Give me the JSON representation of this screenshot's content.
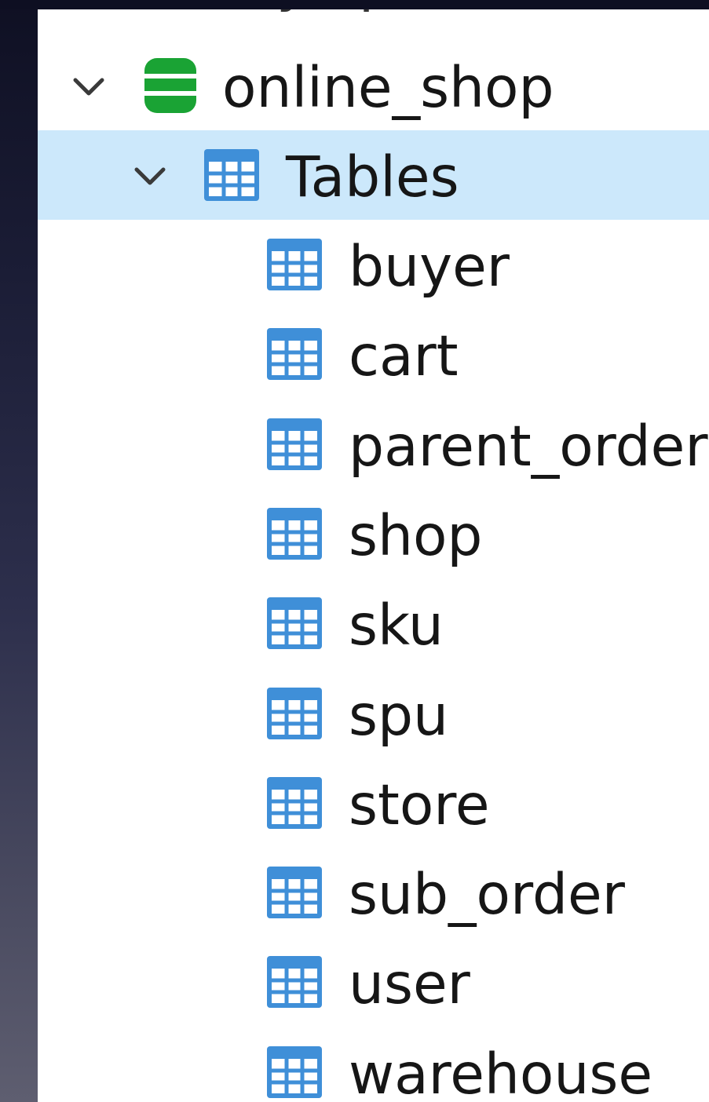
{
  "tree": {
    "connection": {
      "label": "mysql",
      "icon": "database-gray-icon"
    },
    "database": {
      "label": "online_shop",
      "icon": "database-green-icon",
      "expanded": true
    },
    "tables_folder": {
      "label": "Tables",
      "icon": "table-icon",
      "expanded": true,
      "selected": true
    },
    "tables": [
      {
        "label": "buyer",
        "icon": "table-icon"
      },
      {
        "label": "cart",
        "icon": "table-icon"
      },
      {
        "label": "parent_order",
        "icon": "table-icon"
      },
      {
        "label": "shop",
        "icon": "table-icon"
      },
      {
        "label": "sku",
        "icon": "table-icon"
      },
      {
        "label": "spu",
        "icon": "table-icon"
      },
      {
        "label": "store",
        "icon": "table-icon"
      },
      {
        "label": "sub_order",
        "icon": "table-icon"
      },
      {
        "label": "user",
        "icon": "table-icon"
      },
      {
        "label": "warehouse",
        "icon": "table-icon"
      }
    ]
  },
  "colors": {
    "selection": "#cce8fb",
    "table_icon": "#3f8fd8",
    "database_icon": "#1aa334",
    "connection_icon": "#6a6a6a",
    "text": "#161616"
  }
}
